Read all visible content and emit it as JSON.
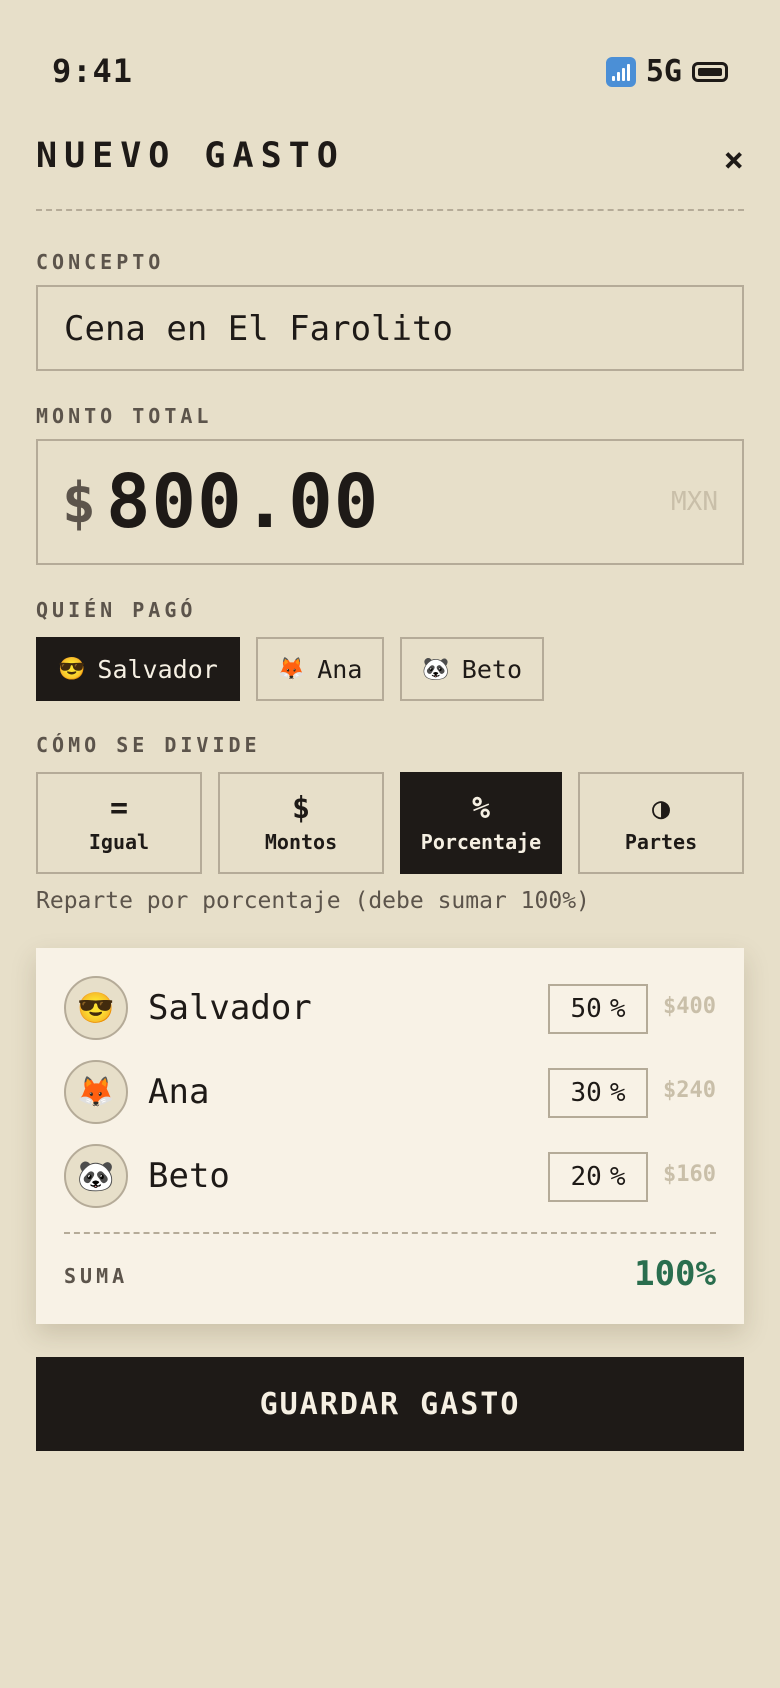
{
  "status_bar": {
    "time": "9:41",
    "network": "5G"
  },
  "header": {
    "title": "NUEVO GASTO",
    "close_icon": "×"
  },
  "concept": {
    "label": "CONCEPTO",
    "value": "Cena en El Farolito"
  },
  "amount": {
    "label": "MONTO TOTAL",
    "symbol": "$",
    "value": "800.00",
    "currency": "MXN"
  },
  "payer": {
    "label": "QUIÉN PAGÓ",
    "selected": "Salvador",
    "options": [
      {
        "emoji": "😎",
        "name": "Salvador",
        "active": true
      },
      {
        "emoji": "🦊",
        "name": "Ana",
        "active": false
      },
      {
        "emoji": "🐼",
        "name": "Beto",
        "active": false
      }
    ]
  },
  "split": {
    "label": "CÓMO SE DIVIDE",
    "selected": "Porcentaje",
    "options": [
      {
        "symbol": "=",
        "label": "Igual",
        "active": false
      },
      {
        "symbol": "$",
        "label": "Montos",
        "active": false
      },
      {
        "symbol": "%",
        "label": "Porcentaje",
        "active": true
      },
      {
        "symbol": "◑",
        "label": "Partes",
        "active": false
      }
    ],
    "hint": "Reparte por porcentaje (debe sumar 100%)"
  },
  "members": [
    {
      "emoji": "😎",
      "name": "Salvador",
      "percent": "50",
      "unit": "%",
      "amount": "$400"
    },
    {
      "emoji": "🦊",
      "name": "Ana",
      "percent": "30",
      "unit": "%",
      "amount": "$240"
    },
    {
      "emoji": "🐼",
      "name": "Beto",
      "percent": "20",
      "unit": "%",
      "amount": "$160"
    }
  ],
  "sum": {
    "label": "SUMA",
    "value": "100%"
  },
  "save_button": {
    "label": "GUARDAR GASTO"
  },
  "colors": {
    "background": "#e7dfc9",
    "ink": "#1e1a17",
    "card": "#f8f2e6",
    "sum_ok": "#2a6e4e",
    "muted": "#c9bfa9"
  }
}
